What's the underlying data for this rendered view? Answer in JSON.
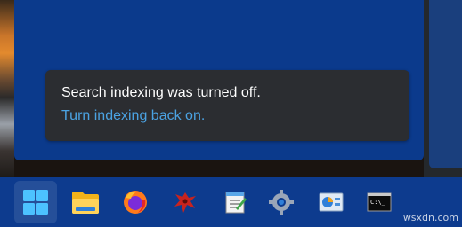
{
  "toast": {
    "message": "Search indexing was turned off.",
    "action_link": "Turn indexing back on."
  },
  "taskbar": {
    "items": [
      {
        "name": "start-button",
        "icon": "windows-logo-icon"
      },
      {
        "name": "file-explorer-button",
        "icon": "folder-icon"
      },
      {
        "name": "firefox-button",
        "icon": "firefox-icon"
      },
      {
        "name": "app-button-red",
        "icon": "red-bug-icon"
      },
      {
        "name": "notepad-button",
        "icon": "notepad-icon"
      },
      {
        "name": "settings-button",
        "icon": "gear-icon"
      },
      {
        "name": "control-panel-button",
        "icon": "control-panel-icon"
      },
      {
        "name": "command-prompt-button",
        "icon": "terminal-icon"
      }
    ]
  },
  "watermark": "wsxdn.com",
  "colors": {
    "panel_blue": "#0b3a8c",
    "toast_bg": "#2b2d31",
    "link_blue": "#4ba3e3",
    "taskbar_bg": "#0d3b8e"
  }
}
